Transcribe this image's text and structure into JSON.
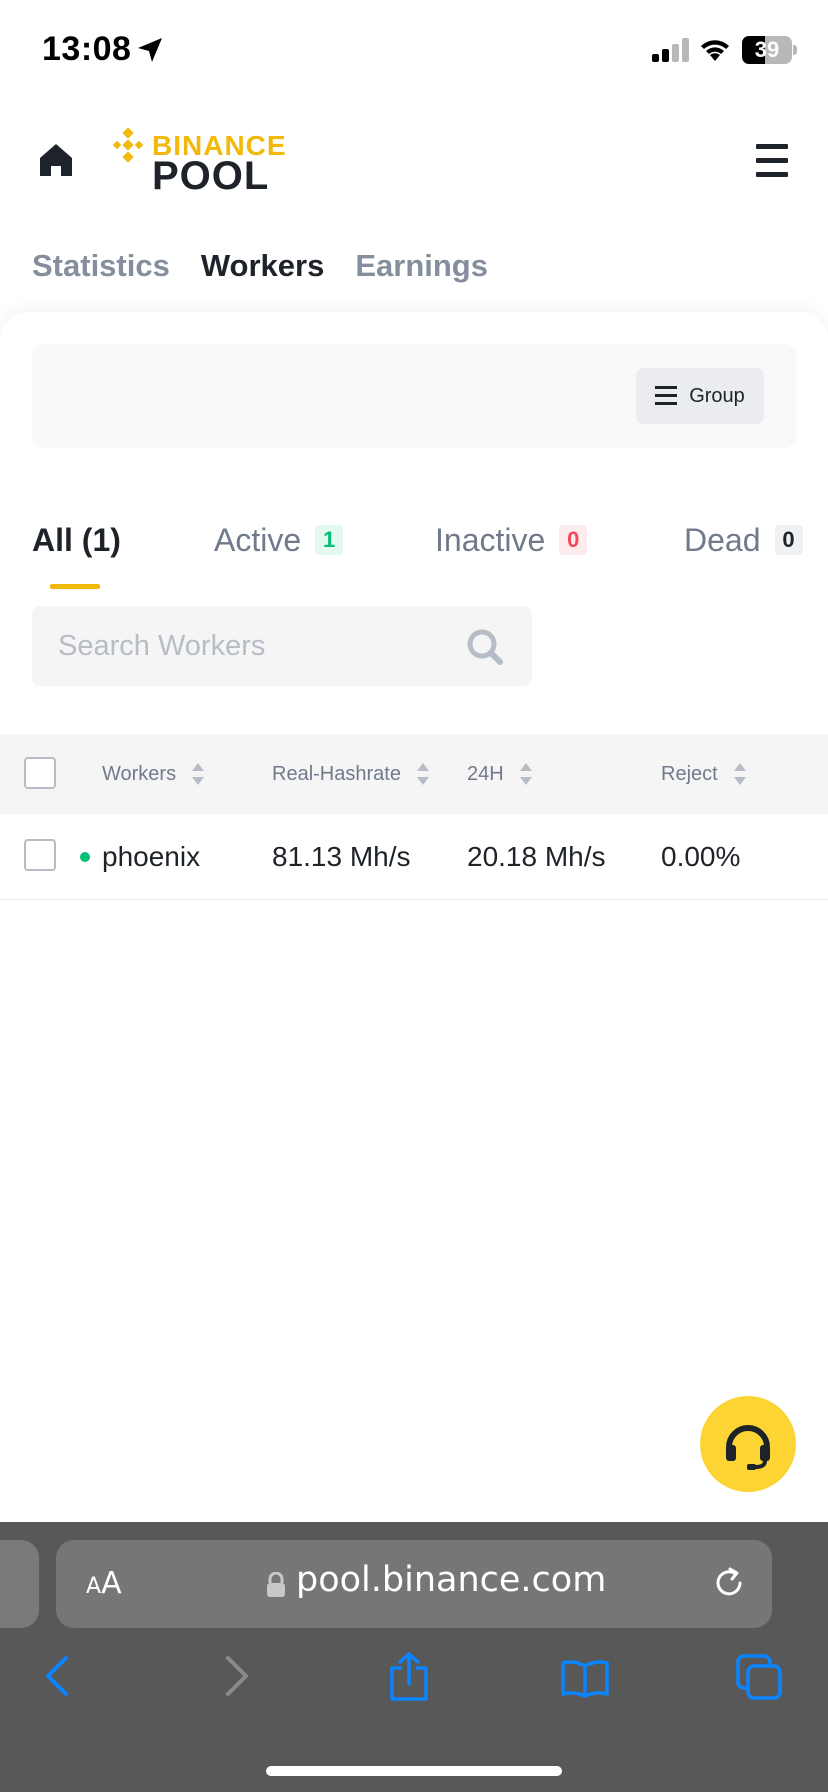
{
  "status_bar": {
    "time": "13:08",
    "battery_level": "39",
    "icons": [
      "location-arrow-icon",
      "signal-icon",
      "wifi-icon",
      "battery-icon"
    ]
  },
  "header": {
    "logo_top": "BINANCE",
    "logo_bottom": "POOL",
    "icons": [
      "home-icon",
      "hamburger-menu-icon"
    ]
  },
  "top_tabs": [
    {
      "label": "Statistics",
      "active": false
    },
    {
      "label": "Workers",
      "active": true
    },
    {
      "label": "Earnings",
      "active": false
    }
  ],
  "filter": {
    "group_label": "Group"
  },
  "status_tabs": {
    "all": "All (1)",
    "active": {
      "label": "Active",
      "count": "1"
    },
    "inactive": {
      "label": "Inactive",
      "count": "0"
    },
    "dead": {
      "label": "Dead",
      "count": "0"
    }
  },
  "search": {
    "placeholder": "Search Workers",
    "value": ""
  },
  "table": {
    "columns": [
      "Workers",
      "Real-Hashrate",
      "24H",
      "Reject"
    ],
    "rows": [
      {
        "worker": "phoenix",
        "status": "active",
        "real_hashrate": "81.13 Mh/s",
        "hashrate_24h": "20.18 Mh/s",
        "reject": "0.00%"
      }
    ]
  },
  "browser": {
    "aa_small": "A",
    "aa_big": "A",
    "url": "pool.binance.com",
    "icons": [
      "back-icon",
      "forward-icon",
      "share-icon",
      "bookmarks-icon",
      "tabs-icon"
    ]
  },
  "colors": {
    "brand_yellow": "#f0b90b",
    "support_yellow": "#fcd535",
    "active_green": "#02c076",
    "inactive_red": "#f6465d",
    "safari_blue": "#0a84ff"
  }
}
